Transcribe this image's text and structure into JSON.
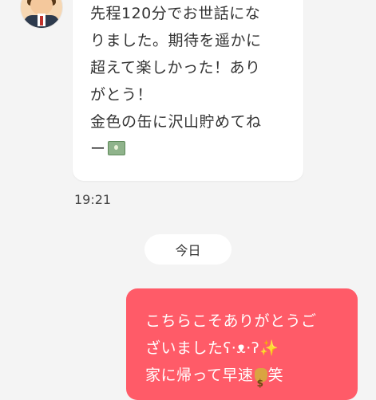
{
  "incoming": {
    "line1": "先程120分でお世話にな",
    "line2": "りました。期待を遥かに",
    "line3": "超えて楽しかった！あり",
    "line4": "がとう！",
    "line5": "金色の缶に沢山貯めてね",
    "line6": "ー",
    "money_icon": "money-bill-icon",
    "time": "19:21"
  },
  "date_divider": "今日",
  "outgoing": {
    "line1": "こちらこそありがとうご",
    "line2_text": "ざいました",
    "line2_emoticon": "ʕ·ᴥ·ʔ",
    "line2_sparkle": "✨",
    "line3_text": "家に帰って早速",
    "line3_icon": "money-bag-icon",
    "line3_end": "笑"
  },
  "colors": {
    "background": "#f4f4f4",
    "incoming_bubble": "#ffffff",
    "outgoing_bubble": "#ff5b68"
  }
}
